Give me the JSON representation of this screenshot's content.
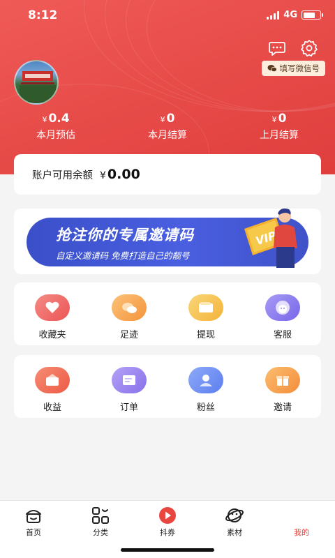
{
  "status": {
    "time": "8:12",
    "network": "4G"
  },
  "header": {
    "wechat_button": "填写微信号",
    "stats": [
      {
        "currency": "¥",
        "value": "0.4",
        "label": "本月预估"
      },
      {
        "currency": "¥",
        "value": "0",
        "label": "本月结算"
      },
      {
        "currency": "¥",
        "value": "0",
        "label": "上月结算"
      }
    ]
  },
  "balance": {
    "label": "账户可用余额",
    "currency": "¥",
    "value": "0.00"
  },
  "banner": {
    "title": "抢注你的专属邀请码",
    "subtitle": "自定义邀请码 免费打造自己的靓号",
    "badge": "VIP"
  },
  "grid_one": [
    {
      "label": "收藏夹",
      "icon": "heart-icon",
      "color": "#f06a6a"
    },
    {
      "label": "足迹",
      "icon": "footprint-icon",
      "color": "#f7a84e"
    },
    {
      "label": "提现",
      "icon": "wallet-icon",
      "color": "#f6c24c"
    },
    {
      "label": "客服",
      "icon": "service-icon",
      "color": "#8a7cf0"
    }
  ],
  "grid_two": [
    {
      "label": "收益",
      "icon": "income-icon",
      "color": "#f26b55"
    },
    {
      "label": "订单",
      "icon": "order-icon",
      "color": "#9b84f2"
    },
    {
      "label": "粉丝",
      "icon": "fans-icon",
      "color": "#6f8ff4"
    },
    {
      "label": "邀请",
      "icon": "gift-icon",
      "color": "#f79d45"
    }
  ],
  "tabs": [
    {
      "label": "首页",
      "icon": "home-icon"
    },
    {
      "label": "分类",
      "icon": "category-icon"
    },
    {
      "label": "抖券",
      "icon": "play-icon"
    },
    {
      "label": "素材",
      "icon": "planet-icon"
    },
    {
      "label": "我的",
      "icon": "",
      "active": true
    }
  ],
  "colors": {
    "primary": "#e84d4a",
    "active_tab": "#e2413b"
  }
}
